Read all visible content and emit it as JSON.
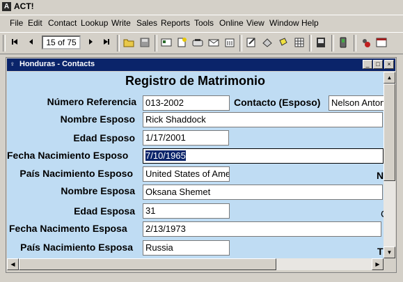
{
  "app": {
    "title": "ACT!"
  },
  "menu": [
    "File",
    "Edit",
    "Contact",
    "Lookup",
    "Write",
    "Sales",
    "Reports",
    "Tools",
    "Online",
    "View",
    "Window",
    "Help"
  ],
  "toolbar": {
    "record_position": "15 of 75",
    "first_icon": "first-record-icon",
    "prev_icon": "previous-record-icon",
    "next_icon": "next-record-icon",
    "last_icon": "last-record-icon"
  },
  "window": {
    "title": "Honduras - Contacts",
    "minimize": "_",
    "maximize": "□",
    "close": "×"
  },
  "form": {
    "title": "Registro de Matrimonio",
    "fields": [
      {
        "label": "Número Referencia",
        "value": "013-2002"
      },
      {
        "label": "Nombre Esposo",
        "value": "Rick Shaddock"
      },
      {
        "label": "Edad Esposo",
        "value": "1/17/2001"
      },
      {
        "label": "Fecha Nacimiento Esposo",
        "value": "7/10/1965"
      },
      {
        "label": "País Nacimiento Esposo",
        "value": "United States of Ame"
      },
      {
        "label": "Nombre Esposa",
        "value": "Oksana Shemet"
      },
      {
        "label": "Edad Esposa",
        "value": "31"
      },
      {
        "label": "Fecha Nacimento Esposa",
        "value": "2/13/1973"
      },
      {
        "label": "País Nacimiento Esposa",
        "value": "Russia"
      }
    ],
    "contact_label": "Contacto (Esposo)",
    "contact_value": "Nelson Anton",
    "edge_chars": [
      "N",
      "C",
      "T"
    ]
  }
}
